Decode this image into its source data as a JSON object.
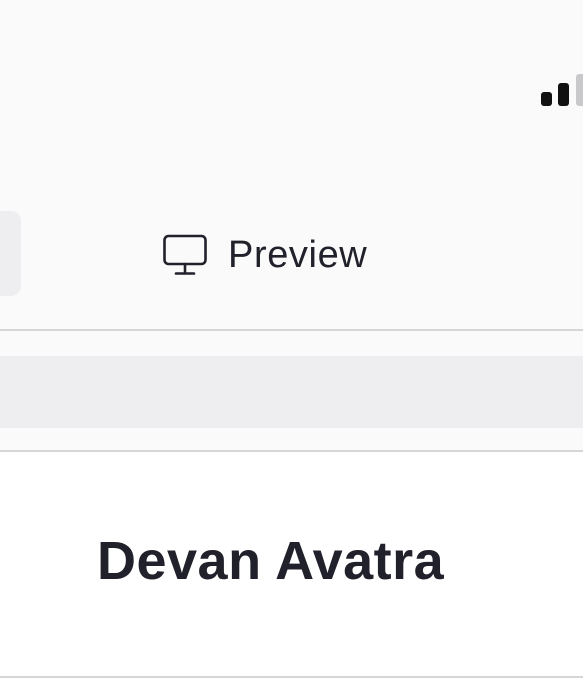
{
  "status_bar": {
    "signal_strength_bars": 2,
    "signal_max_bars": 3,
    "icon": "cellular-signal-icon"
  },
  "toolbar": {
    "preview_label": "Preview",
    "preview_icon": "monitor-icon"
  },
  "profile": {
    "name": "Devan Avatra"
  },
  "colors": {
    "background": "#fafafa",
    "text": "#20212b",
    "divider": "#d6d6d9",
    "input_fill": "#eeeef0",
    "card": "#ffffff"
  }
}
